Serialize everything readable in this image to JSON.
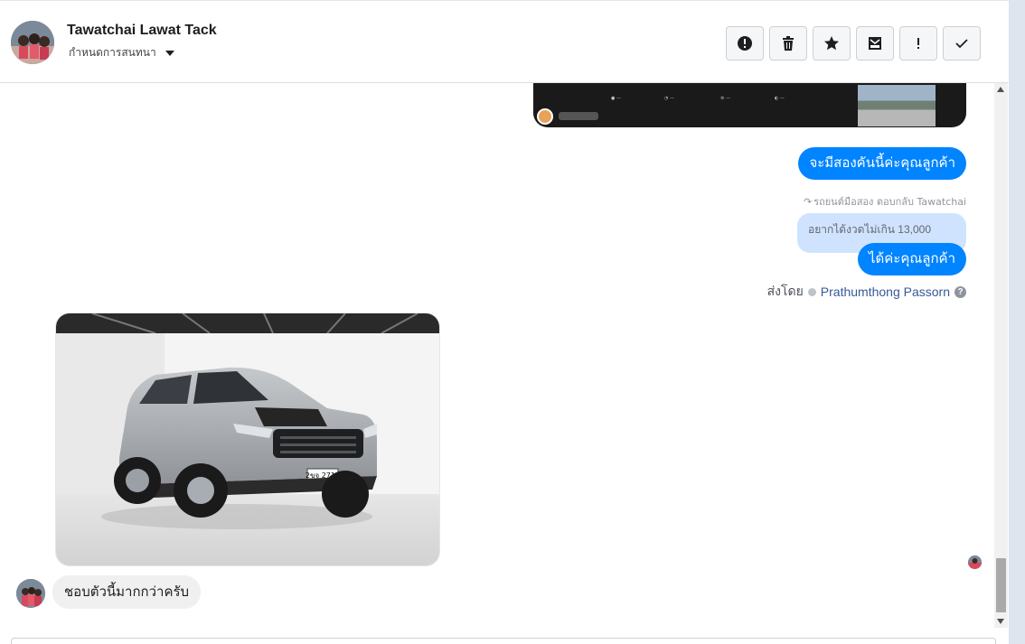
{
  "header": {
    "contact_name": "Tawatchai Lawat Tack",
    "conversation_settings": "กำหนดการสนทนา",
    "actions": [
      {
        "name": "report-spam",
        "icon": "alert-circle-icon"
      },
      {
        "name": "delete",
        "icon": "trash-icon"
      },
      {
        "name": "star",
        "icon": "star-icon"
      },
      {
        "name": "mark-unread",
        "icon": "envelope-icon"
      },
      {
        "name": "important",
        "icon": "exclamation-icon"
      },
      {
        "name": "mark-done",
        "icon": "check-icon"
      }
    ]
  },
  "conversation": {
    "messages": [
      {
        "direction": "outgoing",
        "text": "จะมีสองคันนี้ค่ะคุณลูกค้า"
      },
      {
        "direction": "outgoing",
        "reply_label": "รถยนต์มือสอง ตอบกลับ Tawatchai",
        "quoted_text": "อยากได้งวดไม่เกิน 13,000",
        "text": "ได้ค่ะคุณลูกค้า"
      }
    ],
    "sent_by": {
      "prefix": "ส่งโดย",
      "sender": "Prathumthong Passorn"
    },
    "incoming": {
      "photo_plate": "2ขจ 2717",
      "text": "ชอบตัวนี้มากกว่าครับ"
    }
  },
  "colors": {
    "outgoing_bubble": "#0084ff",
    "incoming_bubble": "#f1f0f0",
    "quoted_bubble": "#cfe3ff",
    "sender_link": "#385898"
  }
}
